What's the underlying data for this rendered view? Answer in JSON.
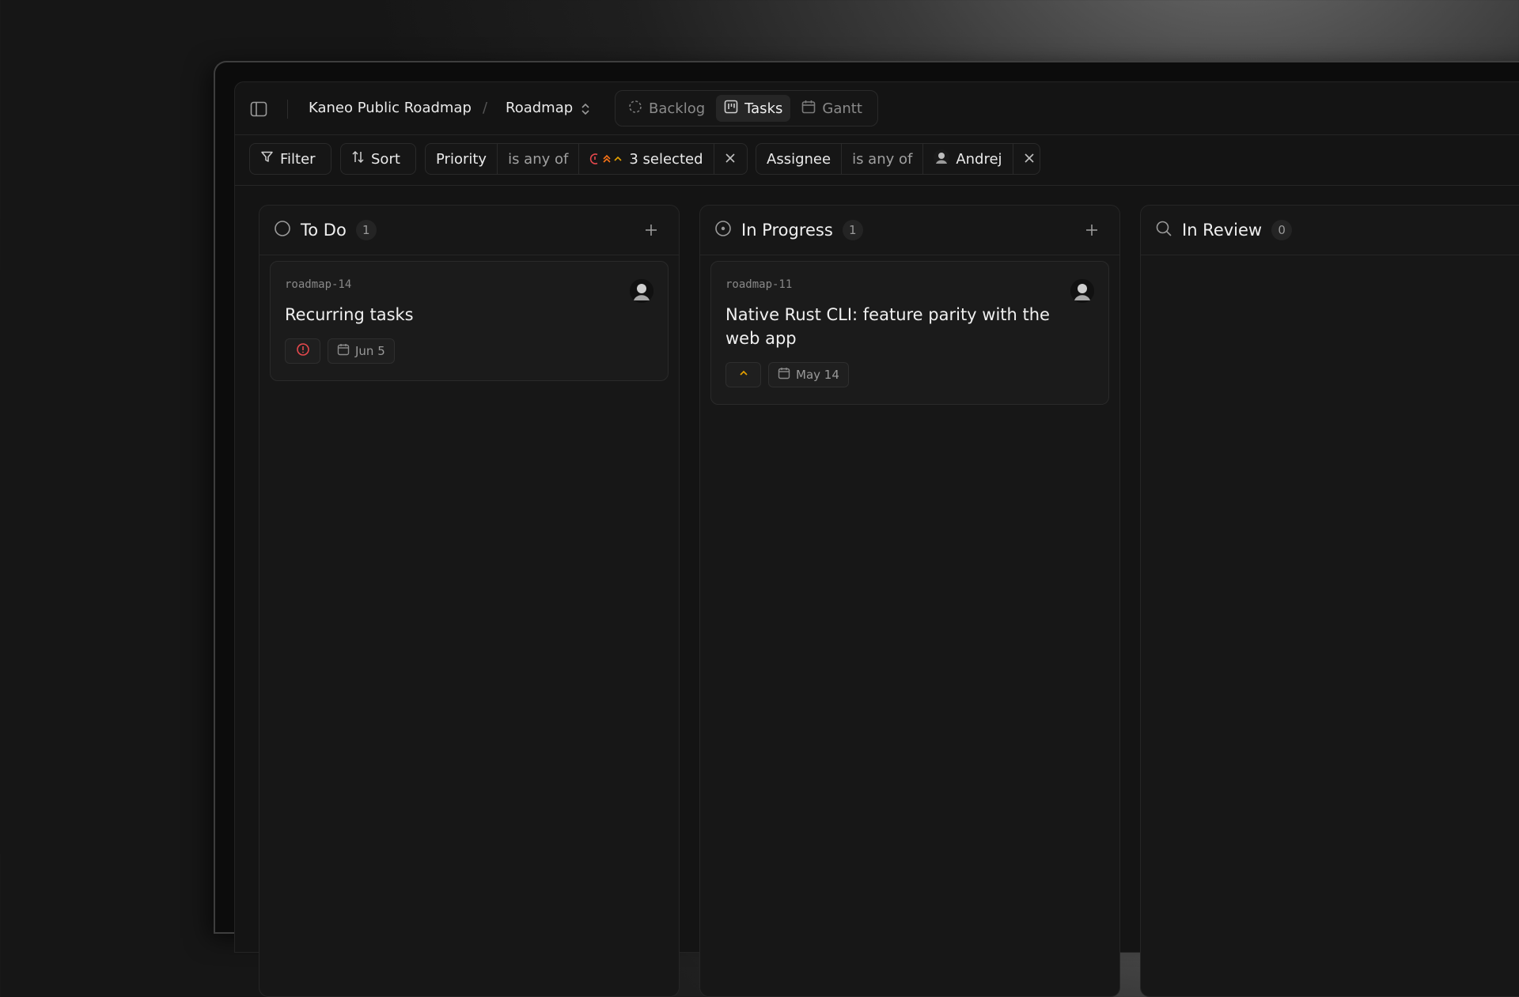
{
  "breadcrumb": {
    "project": "Kaneo Public Roadmap",
    "separator": "/",
    "board": "Roadmap"
  },
  "views": [
    {
      "label": "Backlog",
      "icon": "backlog-icon",
      "active": false
    },
    {
      "label": "Tasks",
      "icon": "kanban-icon",
      "active": true
    },
    {
      "label": "Gantt",
      "icon": "calendar-icon",
      "active": false
    }
  ],
  "toolbar": {
    "filter_label": "Filter",
    "sort_label": "Sort"
  },
  "filters": {
    "priority": {
      "field": "Priority",
      "operator": "is any of",
      "value": "3 selected"
    },
    "assignee": {
      "field": "Assignee",
      "operator": "is any of",
      "value": "Andrej"
    }
  },
  "columns": [
    {
      "title": "To Do",
      "count": "1",
      "status_icon": "circle-icon",
      "cards": [
        {
          "id": "roadmap-14",
          "title": "Recurring tasks",
          "priority_icon": "urgent-alert-icon",
          "due": "Jun 5"
        }
      ]
    },
    {
      "title": "In Progress",
      "count": "1",
      "status_icon": "circle-dot-icon",
      "cards": [
        {
          "id": "roadmap-11",
          "title": "Native Rust CLI: feature parity with the web app",
          "priority_icon": "chevron-up-icon",
          "due": "May 14"
        }
      ]
    },
    {
      "title": "In Review",
      "count": "0",
      "status_icon": "search-icon",
      "cards": []
    }
  ],
  "colors": {
    "urgent": "#e5484d",
    "medium": "#e5a000",
    "high": "#f97316"
  }
}
